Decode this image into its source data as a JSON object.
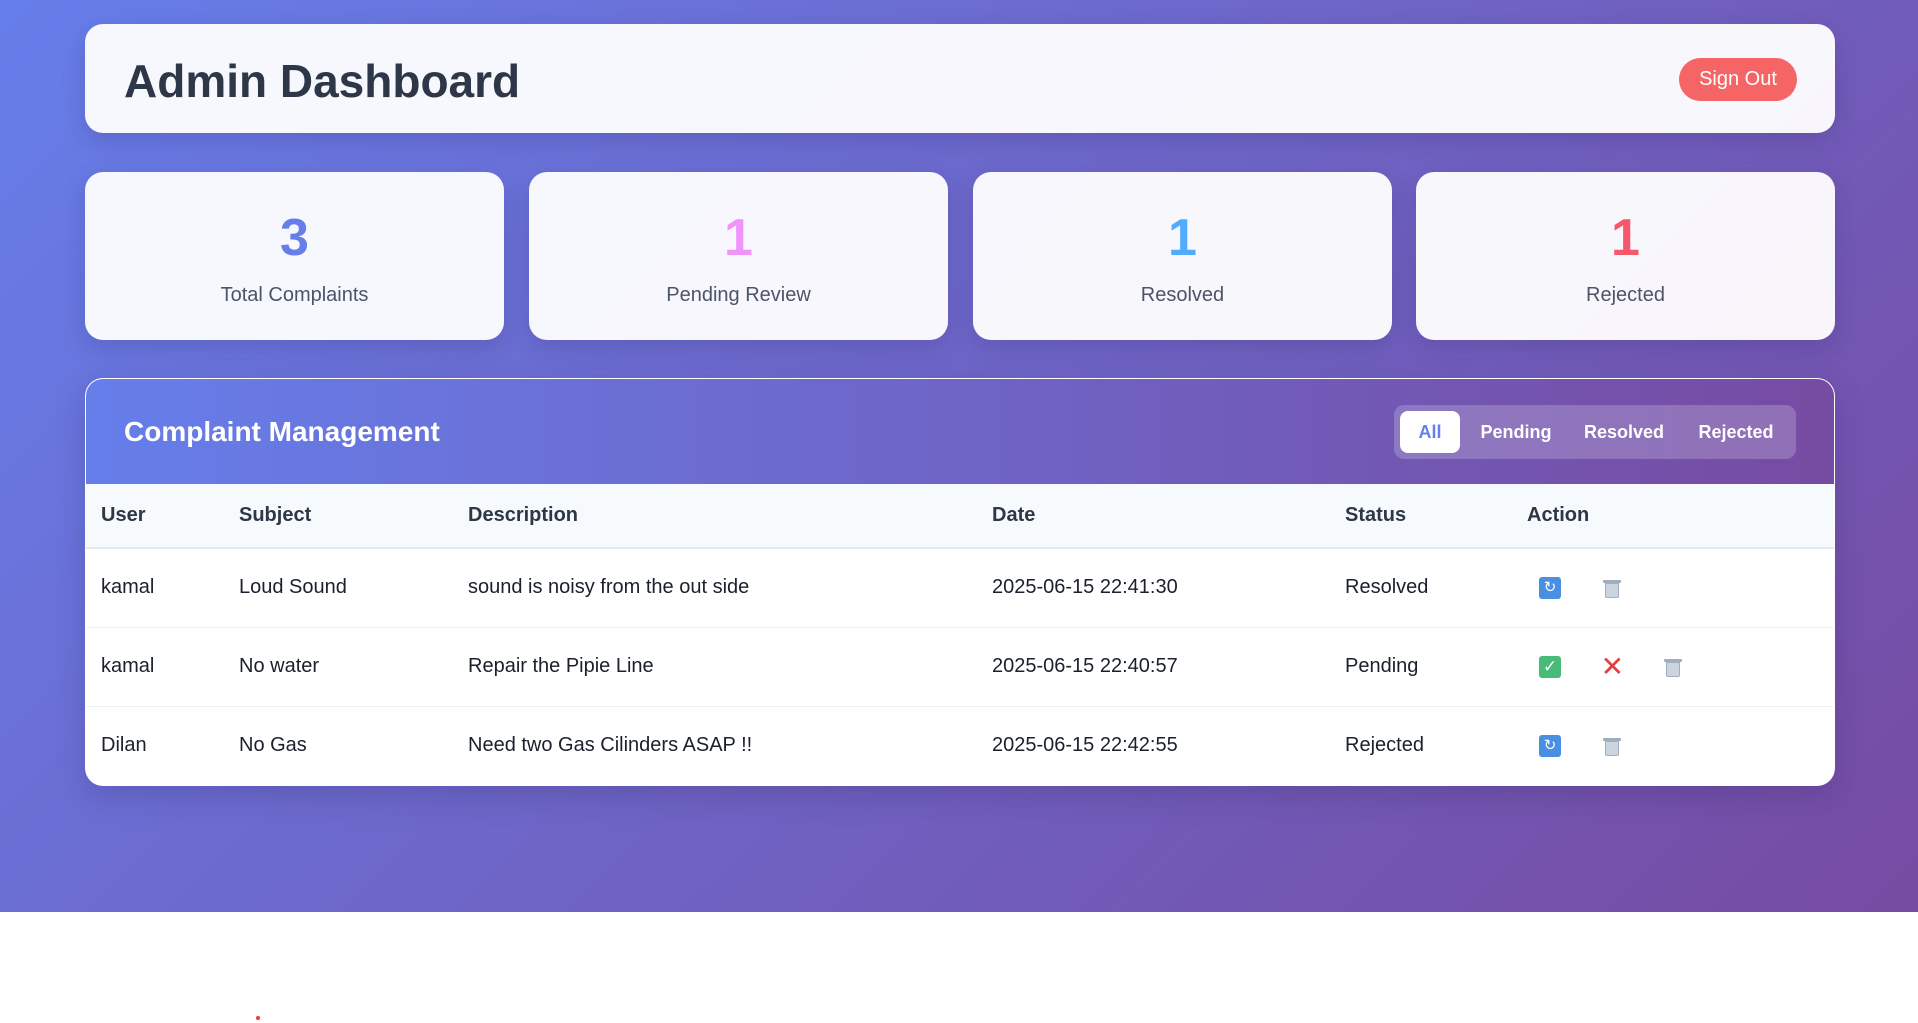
{
  "header": {
    "title": "Admin Dashboard",
    "signout_label": "Sign Out"
  },
  "stats": [
    {
      "value": "3",
      "label": "Total Complaints",
      "color": "#667eea"
    },
    {
      "value": "1",
      "label": "Pending Review",
      "color": "#f093fb"
    },
    {
      "value": "1",
      "label": "Resolved",
      "color": "#4facfe"
    },
    {
      "value": "1",
      "label": "Rejected",
      "color": "#f5576c"
    }
  ],
  "management": {
    "title": "Complaint Management",
    "filters": [
      "All",
      "Pending",
      "Resolved",
      "Rejected"
    ],
    "active_filter": "All"
  },
  "table": {
    "columns": [
      "User",
      "Subject",
      "Description",
      "Date",
      "Status",
      "Action"
    ],
    "rows": [
      {
        "user": "kamal",
        "subject": "Loud Sound",
        "description": "sound is noisy from the out side",
        "date": "2025-06-15 22:41:30",
        "status": "Resolved",
        "actions": [
          "refresh-icon",
          "trash-icon"
        ]
      },
      {
        "user": "kamal",
        "subject": "No water",
        "description": "Repair the Pipie Line",
        "date": "2025-06-15 22:40:57",
        "status": "Pending",
        "actions": [
          "check-icon",
          "x-icon",
          "trash-icon"
        ]
      },
      {
        "user": "Dilan",
        "subject": "No Gas",
        "description": "Need two Gas Cilinders ASAP !!",
        "date": "2025-06-15 22:42:55",
        "status": "Rejected",
        "actions": [
          "refresh-icon",
          "trash-icon"
        ]
      }
    ]
  }
}
